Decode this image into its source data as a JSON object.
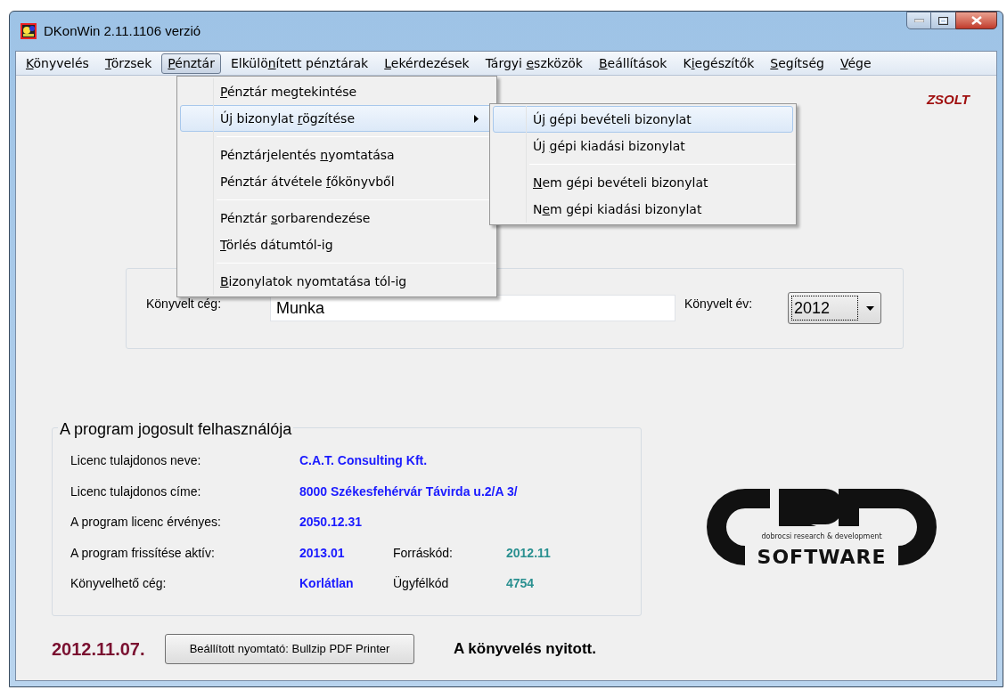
{
  "window": {
    "title": "DKonWin 2.11.1106 verzió"
  },
  "menu_bar": [
    {
      "key": "K",
      "after": "önyvelés",
      "selected": false
    },
    {
      "key": "T",
      "after": "örzsek",
      "selected": false
    },
    {
      "key": "P",
      "after": "énztár",
      "selected": true
    },
    {
      "before": "Elkülö",
      "key": "n",
      "after": "ített pénztárak",
      "selected": false
    },
    {
      "key": "L",
      "after": "ekérdezések",
      "selected": false
    },
    {
      "before": "Tárgyi ",
      "key": "e",
      "after": "szközök",
      "selected": false
    },
    {
      "key": "B",
      "after": "eállítások",
      "selected": false
    },
    {
      "before": "K",
      "key": "i",
      "after": "egészítők",
      "selected": false
    },
    {
      "key": "S",
      "after": "egítség",
      "selected": false
    },
    {
      "key": "V",
      "after": "ége",
      "selected": false
    }
  ],
  "dropdown": [
    {
      "kind": "item",
      "key": "P",
      "after": "énztár megtekintése",
      "selected": false,
      "submenu": false
    },
    {
      "kind": "item",
      "before": "Új bizonylat ",
      "key": "r",
      "after": "ögzítése",
      "selected": true,
      "submenu": true
    },
    {
      "kind": "separator"
    },
    {
      "kind": "item",
      "before": "Pénztárjelentés ",
      "key": "n",
      "after": "yomtatása",
      "selected": false,
      "submenu": false
    },
    {
      "kind": "item",
      "before": "Pénztár átvétele ",
      "key": "f",
      "after": "őkönyvből",
      "selected": false,
      "submenu": false
    },
    {
      "kind": "separator"
    },
    {
      "kind": "item",
      "before": "Pénztár ",
      "key": "s",
      "after": "orbarendezése",
      "selected": false,
      "submenu": false
    },
    {
      "kind": "item",
      "key": "T",
      "after": "örlés dátumtól-ig",
      "selected": false,
      "submenu": false
    },
    {
      "kind": "separator"
    },
    {
      "kind": "item",
      "key": "B",
      "after": "izonylatok nyomtatása tól-ig",
      "selected": false,
      "submenu": false
    }
  ],
  "submenu": [
    {
      "kind": "item",
      "before": "Ú",
      "key": "j",
      "after": " gépi bevételi bizonylat",
      "selected": true
    },
    {
      "kind": "item",
      "before": "Új ",
      "key": "g",
      "after": "épi kiadási bizonylat",
      "selected": false
    },
    {
      "kind": "separator"
    },
    {
      "kind": "item",
      "key": "N",
      "after": "em gépi bevételi bizonylat",
      "selected": false
    },
    {
      "kind": "item",
      "before": "N",
      "key": "e",
      "after": "m gépi kiadási bizonylat",
      "selected": false
    }
  ],
  "user_name": "ZSOLT",
  "company_form": {
    "company_label": "Könyvelt cég:",
    "company_value": "Munka",
    "year_label": "Könyvelt év:",
    "year_value": "2012"
  },
  "license": {
    "title": "A program jogosult felhasználója",
    "rows": [
      {
        "label": "Licenc tulajdonos neve:",
        "value": "C.A.T. Consulting Kft."
      },
      {
        "label": "Licenc tulajdonos címe:",
        "value": "8000 Székesfehérvár Távirda u.2/A 3/"
      },
      {
        "label": "A program licenc érvényes:",
        "value": "2050.12.31"
      },
      {
        "label": "A program frissítése aktív:",
        "value": "2013.01",
        "label_2": "Forráskód:",
        "value_2": "2012.11"
      },
      {
        "label": "Könyvelhető cég:",
        "value": "Korlátlan",
        "label_2": "Ügyfélkód",
        "value_2": "4754"
      }
    ]
  },
  "logo": {
    "tagline": "dobrocsi research & development",
    "text": "SOFTWARE"
  },
  "status": {
    "date": "2012.11.07.",
    "printer_button": "Beállított nyomtató: Bullzip PDF Printer",
    "message": "A könyvelés nyitott."
  }
}
